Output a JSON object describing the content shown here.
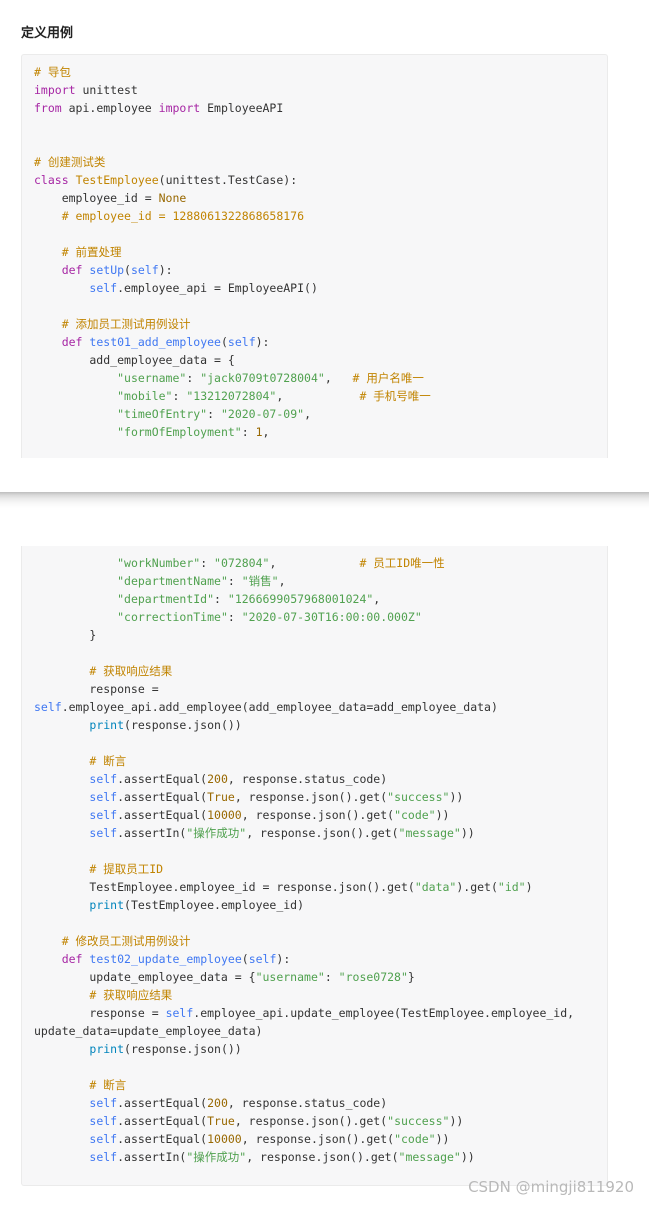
{
  "heading": "定义用例",
  "watermark": "CSDN @mingji811920",
  "colors": {
    "keyword": "#a626a4",
    "comment": "#c18401",
    "string": "#50a14f",
    "number": "#986801",
    "function": "#4078f2",
    "builtin": "#0184bc",
    "text": "#333333",
    "code_background": "#f7f7f8"
  },
  "code_block_1": [
    [
      [
        "c",
        "# 导包"
      ]
    ],
    [
      [
        "kw",
        "import"
      ],
      [
        "p",
        " unittest"
      ]
    ],
    [
      [
        "kw",
        "from"
      ],
      [
        "p",
        " api.employee "
      ],
      [
        "kw",
        "import"
      ],
      [
        "p",
        " EmployeeAPI"
      ]
    ],
    [],
    [],
    [
      [
        "c",
        "# 创建测试类"
      ]
    ],
    [
      [
        "kw",
        "class"
      ],
      [
        "p",
        " "
      ],
      [
        "cls",
        "TestEmployee"
      ],
      [
        "p",
        "(unittest.TestCase):"
      ]
    ],
    [
      [
        "p",
        "    employee_id = "
      ],
      [
        "n",
        "None"
      ]
    ],
    [
      [
        "p",
        "    "
      ],
      [
        "c",
        "# employee_id = 1288061322868658176"
      ]
    ],
    [],
    [
      [
        "p",
        "    "
      ],
      [
        "c",
        "# 前置处理"
      ]
    ],
    [
      [
        "p",
        "    "
      ],
      [
        "kw",
        "def"
      ],
      [
        "p",
        " "
      ],
      [
        "fn",
        "setUp"
      ],
      [
        "p",
        "("
      ],
      [
        "sf",
        "self"
      ],
      [
        "p",
        "):"
      ]
    ],
    [
      [
        "p",
        "        "
      ],
      [
        "sf",
        "self"
      ],
      [
        "p",
        ".employee_api = EmployeeAPI()"
      ]
    ],
    [],
    [
      [
        "p",
        "    "
      ],
      [
        "c",
        "# 添加员工测试用例设计"
      ]
    ],
    [
      [
        "p",
        "    "
      ],
      [
        "kw",
        "def"
      ],
      [
        "p",
        " "
      ],
      [
        "fn",
        "test01_add_employee"
      ],
      [
        "p",
        "("
      ],
      [
        "sf",
        "self"
      ],
      [
        "p",
        "):"
      ]
    ],
    [
      [
        "p",
        "        add_employee_data = {"
      ]
    ],
    [
      [
        "p",
        "            "
      ],
      [
        "s",
        "\"username\""
      ],
      [
        "p",
        ": "
      ],
      [
        "s",
        "\"jack0709t0728004\""
      ],
      [
        "p",
        ",   "
      ],
      [
        "c",
        "# 用户名唯一"
      ]
    ],
    [
      [
        "p",
        "            "
      ],
      [
        "s",
        "\"mobile\""
      ],
      [
        "p",
        ": "
      ],
      [
        "s",
        "\"13212072804\""
      ],
      [
        "p",
        ",           "
      ],
      [
        "c",
        "# 手机号唯一"
      ]
    ],
    [
      [
        "p",
        "            "
      ],
      [
        "s",
        "\"timeOfEntry\""
      ],
      [
        "p",
        ": "
      ],
      [
        "s",
        "\"2020-07-09\""
      ],
      [
        "p",
        ","
      ]
    ],
    [
      [
        "p",
        "            "
      ],
      [
        "s",
        "\"formOfEmployment\""
      ],
      [
        "p",
        ": "
      ],
      [
        "n",
        "1"
      ],
      [
        "p",
        ","
      ]
    ]
  ],
  "code_block_2": [
    [
      [
        "p",
        "            "
      ],
      [
        "s",
        "\"workNumber\""
      ],
      [
        "p",
        ": "
      ],
      [
        "s",
        "\"072804\""
      ],
      [
        "p",
        ",            "
      ],
      [
        "c",
        "# 员工ID唯一性"
      ]
    ],
    [
      [
        "p",
        "            "
      ],
      [
        "s",
        "\"departmentName\""
      ],
      [
        "p",
        ": "
      ],
      [
        "s",
        "\"销售\""
      ],
      [
        "p",
        ","
      ]
    ],
    [
      [
        "p",
        "            "
      ],
      [
        "s",
        "\"departmentId\""
      ],
      [
        "p",
        ": "
      ],
      [
        "s",
        "\"1266699057968001024\""
      ],
      [
        "p",
        ","
      ]
    ],
    [
      [
        "p",
        "            "
      ],
      [
        "s",
        "\"correctionTime\""
      ],
      [
        "p",
        ": "
      ],
      [
        "s",
        "\"2020-07-30T16:00:00.000Z\""
      ]
    ],
    [
      [
        "p",
        "        }"
      ]
    ],
    [],
    [
      [
        "p",
        "        "
      ],
      [
        "c",
        "# 获取响应结果"
      ]
    ],
    [
      [
        "p",
        "        response ="
      ]
    ],
    [
      [
        "sf",
        "self"
      ],
      [
        "p",
        ".employee_api.add_employee(add_employee_data=add_employee_data)"
      ]
    ],
    [
      [
        "p",
        "        "
      ],
      [
        "b",
        "print"
      ],
      [
        "p",
        "(response.json())"
      ]
    ],
    [],
    [
      [
        "p",
        "        "
      ],
      [
        "c",
        "# 断言"
      ]
    ],
    [
      [
        "p",
        "        "
      ],
      [
        "sf",
        "self"
      ],
      [
        "p",
        ".assertEqual("
      ],
      [
        "n",
        "200"
      ],
      [
        "p",
        ", response.status_code)"
      ]
    ],
    [
      [
        "p",
        "        "
      ],
      [
        "sf",
        "self"
      ],
      [
        "p",
        ".assertEqual("
      ],
      [
        "n",
        "True"
      ],
      [
        "p",
        ", response.json().get("
      ],
      [
        "s",
        "\"success\""
      ],
      [
        "p",
        "))"
      ]
    ],
    [
      [
        "p",
        "        "
      ],
      [
        "sf",
        "self"
      ],
      [
        "p",
        ".assertEqual("
      ],
      [
        "n",
        "10000"
      ],
      [
        "p",
        ", response.json().get("
      ],
      [
        "s",
        "\"code\""
      ],
      [
        "p",
        "))"
      ]
    ],
    [
      [
        "p",
        "        "
      ],
      [
        "sf",
        "self"
      ],
      [
        "p",
        ".assertIn("
      ],
      [
        "s",
        "\"操作成功\""
      ],
      [
        "p",
        ", response.json().get("
      ],
      [
        "s",
        "\"message\""
      ],
      [
        "p",
        "))"
      ]
    ],
    [],
    [
      [
        "p",
        "        "
      ],
      [
        "c",
        "# 提取员工ID"
      ]
    ],
    [
      [
        "p",
        "        TestEmployee.employee_id = response.json().get("
      ],
      [
        "s",
        "\"data\""
      ],
      [
        "p",
        ").get("
      ],
      [
        "s",
        "\"id\""
      ],
      [
        "p",
        ")"
      ]
    ],
    [
      [
        "p",
        "        "
      ],
      [
        "b",
        "print"
      ],
      [
        "p",
        "(TestEmployee.employee_id)"
      ]
    ],
    [],
    [
      [
        "p",
        "    "
      ],
      [
        "c",
        "# 修改员工测试用例设计"
      ]
    ],
    [
      [
        "p",
        "    "
      ],
      [
        "kw",
        "def"
      ],
      [
        "p",
        " "
      ],
      [
        "fn",
        "test02_update_employee"
      ],
      [
        "p",
        "("
      ],
      [
        "sf",
        "self"
      ],
      [
        "p",
        "):"
      ]
    ],
    [
      [
        "p",
        "        update_employee_data = {"
      ],
      [
        "s",
        "\"username\""
      ],
      [
        "p",
        ": "
      ],
      [
        "s",
        "\"rose0728\""
      ],
      [
        "p",
        "}"
      ]
    ],
    [
      [
        "p",
        "        "
      ],
      [
        "c",
        "# 获取响应结果"
      ]
    ],
    [
      [
        "p",
        "        response = "
      ],
      [
        "sf",
        "self"
      ],
      [
        "p",
        ".employee_api.update_employee(TestEmployee.employee_id,"
      ]
    ],
    [
      [
        "p",
        "update_data=update_employee_data)"
      ]
    ],
    [
      [
        "p",
        "        "
      ],
      [
        "b",
        "print"
      ],
      [
        "p",
        "(response.json())"
      ]
    ],
    [],
    [
      [
        "p",
        "        "
      ],
      [
        "c",
        "# 断言"
      ]
    ],
    [
      [
        "p",
        "        "
      ],
      [
        "sf",
        "self"
      ],
      [
        "p",
        ".assertEqual("
      ],
      [
        "n",
        "200"
      ],
      [
        "p",
        ", response.status_code)"
      ]
    ],
    [
      [
        "p",
        "        "
      ],
      [
        "sf",
        "self"
      ],
      [
        "p",
        ".assertEqual("
      ],
      [
        "n",
        "True"
      ],
      [
        "p",
        ", response.json().get("
      ],
      [
        "s",
        "\"success\""
      ],
      [
        "p",
        "))"
      ]
    ],
    [
      [
        "p",
        "        "
      ],
      [
        "sf",
        "self"
      ],
      [
        "p",
        ".assertEqual("
      ],
      [
        "n",
        "10000"
      ],
      [
        "p",
        ", response.json().get("
      ],
      [
        "s",
        "\"code\""
      ],
      [
        "p",
        "))"
      ]
    ],
    [
      [
        "p",
        "        "
      ],
      [
        "sf",
        "self"
      ],
      [
        "p",
        ".assertIn("
      ],
      [
        "s",
        "\"操作成功\""
      ],
      [
        "p",
        ", response.json().get("
      ],
      [
        "s",
        "\"message\""
      ],
      [
        "p",
        "))"
      ]
    ]
  ]
}
